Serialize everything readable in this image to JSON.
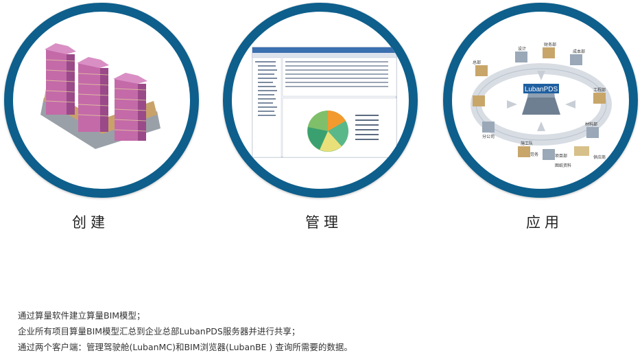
{
  "sections": [
    {
      "label": "创建",
      "image": "bim-building-model"
    },
    {
      "label": "管理",
      "image": "software-screenshot-pie-chart"
    },
    {
      "label": "应用",
      "image": "lubanpds-collaboration-diagram"
    }
  ],
  "diagram": {
    "center": "LubanPDS",
    "nodes": [
      "总部",
      "设计",
      "财务部",
      "成本部",
      "工程部",
      "材料部",
      "供应商",
      "项目部",
      "劳务",
      "施工队",
      "分公司",
      "图纸资料"
    ]
  },
  "description": [
    "通过算量软件建立算量BIM模型；",
    "企业所有项目算量BIM模型汇总到企业总部LubanPDS服务器并进行共享；",
    "通过两个客户端：管理驾驶舱(LubanMC)和BIM浏览器(LubanBE ) 查询所需要的数据。"
  ],
  "colors": {
    "ring": "#0e5f8c",
    "building": "#c46aa8"
  }
}
